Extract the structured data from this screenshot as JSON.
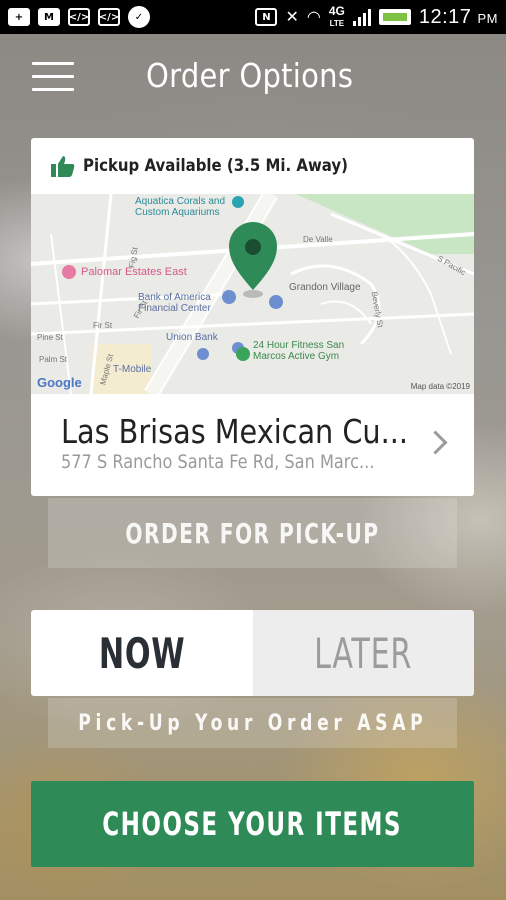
{
  "status_bar": {
    "time": "12:17",
    "ampm": "PM",
    "network": "4G",
    "network_sub": "LTE",
    "icons_left": [
      "plus-icon",
      "gmail-icon",
      "code-icon",
      "code-icon",
      "chat-icon",
      "nfc-icon",
      "mute-icon",
      "wifi-icon"
    ]
  },
  "header": {
    "title": "Order Options"
  },
  "location_card": {
    "availability": "Pickup Available (3.5 Mi. Away)",
    "restaurant_name": "Las Brisas Mexican Cu...",
    "address": "577 S Rancho Santa Fe Rd, San Marc...",
    "map": {
      "labels": {
        "aquatica": "Aquatica Corals and\nCustom Aquariums",
        "palomar": "Palomar Estates East",
        "bofa": "Bank of America\nFinancial Center",
        "grandon": "Grandon Village",
        "union_bank": "Union Bank",
        "fitness": "24 Hour Fitness San\nMarcos Active Gym",
        "tmobile": "T-Mobile",
        "de_valle": "De Valle",
        "pacific": "S Pacific",
        "fig_st": "Fig St",
        "fir_st": "Fir St",
        "pine_st": "Pine St",
        "palm_st": "Palm St",
        "maple_st": "Maple St",
        "beverly_st": "Beverly St",
        "fir_st2": "Fir St"
      },
      "google": "Google",
      "attribution": "Map data ©2019"
    },
    "accent_color": "#2e8b57"
  },
  "buttons": {
    "order_pickup": "ORDER FOR PICK-UP",
    "now": "NOW",
    "later": "LATER",
    "asap": "Pick-Up Your Order ASAP",
    "choose_items": "CHOOSE YOUR ITEMS"
  },
  "colors": {
    "primary_green": "#2e8b57",
    "dark_text": "#2a2e35",
    "muted_text": "#9c9c9c"
  }
}
